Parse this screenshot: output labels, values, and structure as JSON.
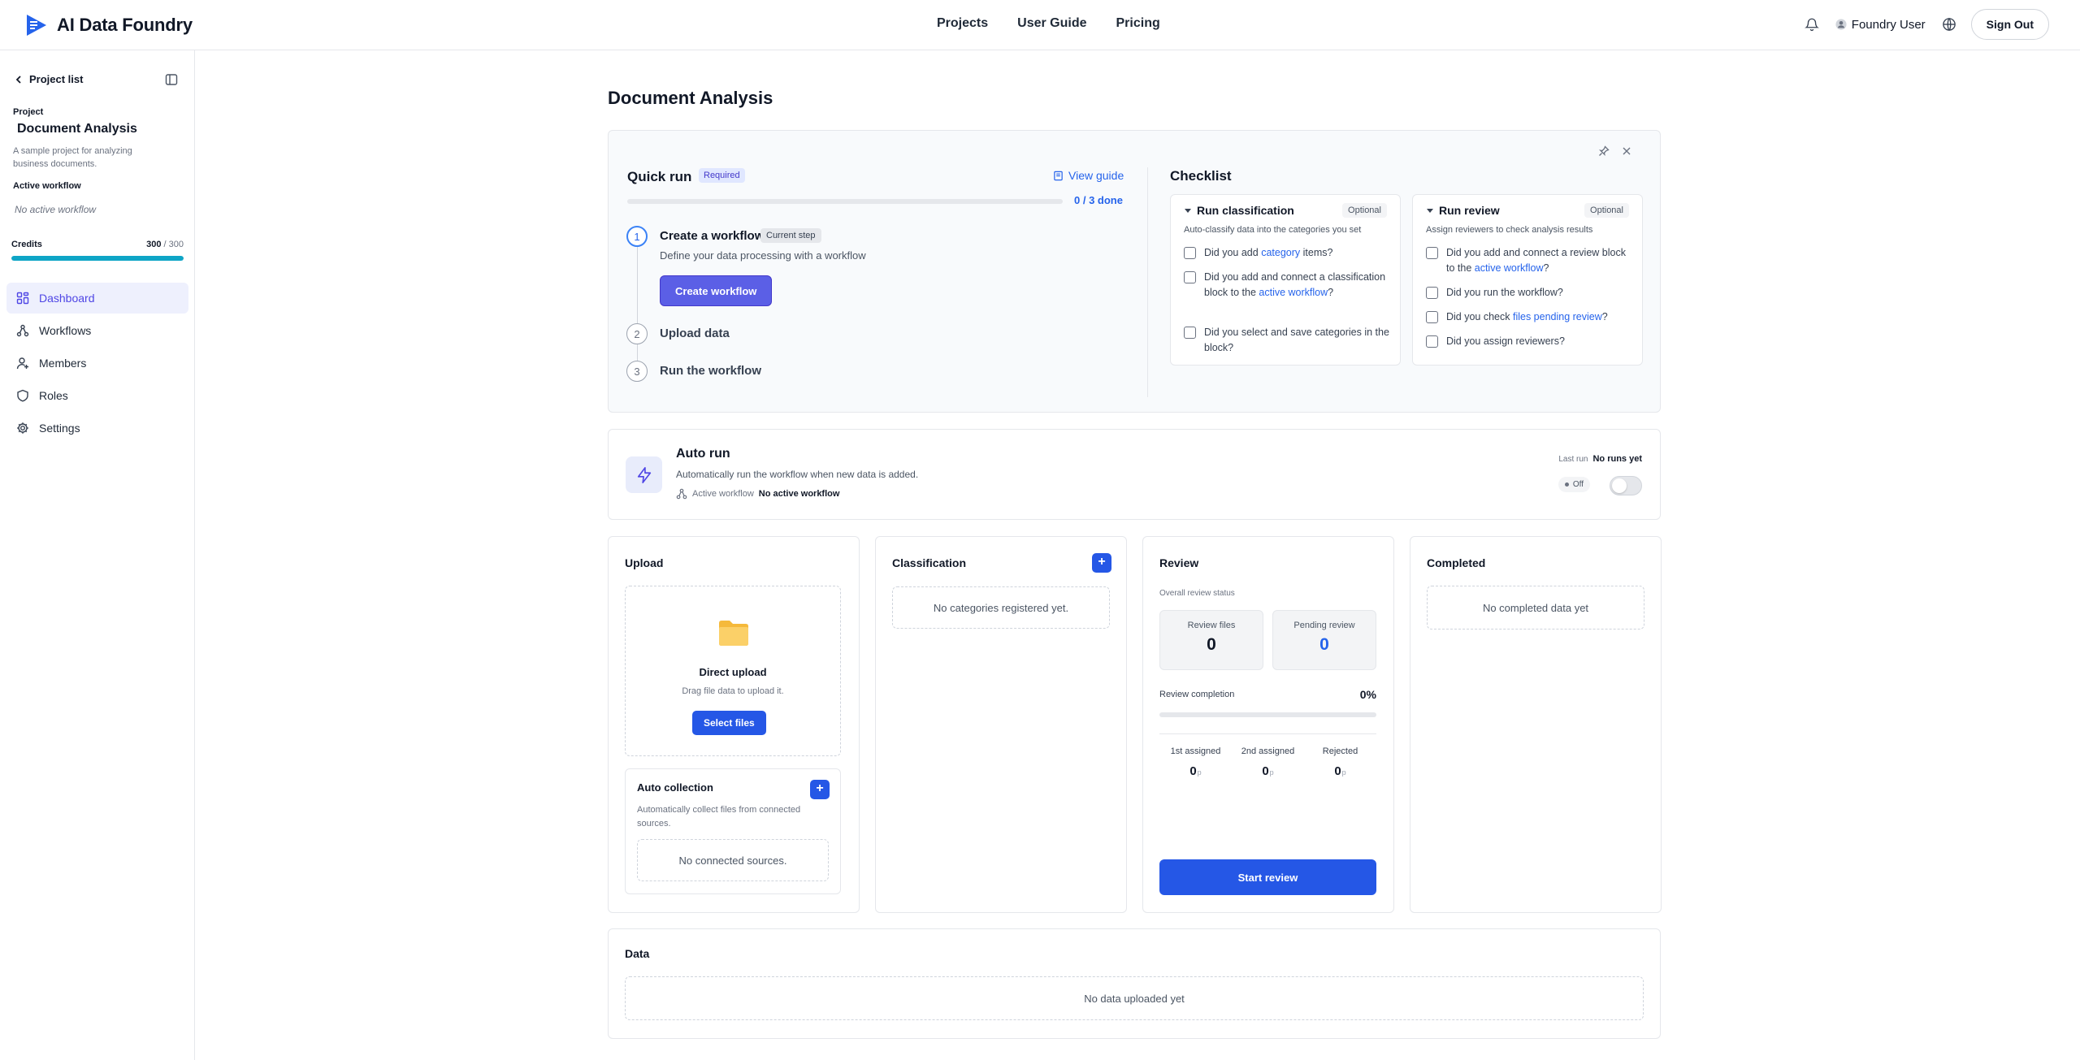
{
  "app": {
    "name": "AI Data Foundry"
  },
  "nav": {
    "projects": "Projects",
    "guide": "User Guide",
    "pricing": "Pricing"
  },
  "user": {
    "name": "Foundry User",
    "signout": "Sign Out"
  },
  "sidebar": {
    "back_label": "Project list",
    "project_label": "Project",
    "project_name": "Document Analysis",
    "project_desc": "A sample project for analyzing business documents.",
    "active_wf_label": "Active workflow",
    "active_wf_value": "No active workflow",
    "credits_label": "Credits",
    "credits_used": "300",
    "credits_total": " / 300",
    "credits_fraction": 1.0,
    "items": [
      {
        "label": "Dashboard",
        "icon": "grid-icon",
        "active": true
      },
      {
        "label": "Workflows",
        "icon": "workflow-icon"
      },
      {
        "label": "Members",
        "icon": "member-icon"
      },
      {
        "label": "Roles",
        "icon": "shield-icon"
      },
      {
        "label": "Settings",
        "icon": "gear-icon"
      }
    ]
  },
  "page": {
    "title": "Document Analysis"
  },
  "quick_run": {
    "title": "Quick run",
    "badge": "Required",
    "view_guide": "View guide",
    "progress_text": "0 / 3 done",
    "progress_fraction": 0,
    "steps": [
      {
        "num": "1",
        "title": "Create a workflow",
        "badge": "Current step",
        "desc": "Define your data processing with a workflow",
        "button": "Create workflow"
      },
      {
        "num": "2",
        "title": "Upload data"
      },
      {
        "num": "3",
        "title": "Run the workflow"
      }
    ]
  },
  "checklist": {
    "title": "Checklist",
    "classification": {
      "title": "Run classification",
      "badge": "Optional",
      "desc": "Auto-classify data into the categories you set",
      "items": [
        {
          "pre": "Did you add ",
          "hl": "category",
          "post": " items?"
        },
        {
          "pre": "Did you add and connect a classification block to the ",
          "hl": "active workflow",
          "post": "?"
        },
        {
          "pre": "Did you select and save categories in the block?",
          "hl": "",
          "post": ""
        }
      ]
    },
    "review": {
      "title": "Run review",
      "badge": "Optional",
      "desc": "Assign reviewers to check analysis results",
      "items": [
        {
          "pre": "Did you add and connect a review block to the ",
          "hl": "active workflow",
          "post": "?"
        },
        {
          "pre": "Did you run the workflow?",
          "hl": "",
          "post": ""
        },
        {
          "pre": "Did you check ",
          "hl": "files pending review",
          "post": "?"
        },
        {
          "pre": "Did you assign reviewers?",
          "hl": "",
          "post": ""
        }
      ]
    }
  },
  "auto_run": {
    "title": "Auto run",
    "desc": "Automatically run the workflow when new data is added.",
    "wf_label": "Active workflow",
    "wf_value": "No active workflow",
    "last_run_label": "Last run",
    "last_run_value": "No runs yet",
    "status": "Off"
  },
  "upload": {
    "title": "Upload",
    "drop_title": "Direct upload",
    "drop_sub": "Drag file data to upload it.",
    "select_button": "Select files",
    "auto_title": "Auto collection",
    "auto_desc": "Automatically collect files from connected sources.",
    "auto_empty": "No connected sources."
  },
  "classification": {
    "title": "Classification",
    "empty": "No categories registered yet."
  },
  "review": {
    "title": "Review",
    "subtitle": "Overall review status",
    "review_files_label": "Review files",
    "review_files_value": "0",
    "pending_label": "Pending review",
    "pending_value": "0",
    "completion_label": "Review completion",
    "completion_value": "0%",
    "completion_fraction": 0,
    "first_label": "1st assigned",
    "first_value": "0",
    "second_label": "2nd assigned",
    "second_value": "0",
    "rejected_label": "Rejected",
    "rejected_value": "0",
    "unit": "p",
    "start_button": "Start review"
  },
  "completed": {
    "title": "Completed",
    "empty": "No completed data yet"
  },
  "data_section": {
    "title": "Data",
    "empty": "No data uploaded yet"
  },
  "colors": {
    "accent": "#2557e6",
    "indigo": "#5b5fe6",
    "teal": "#0ea5c6"
  }
}
